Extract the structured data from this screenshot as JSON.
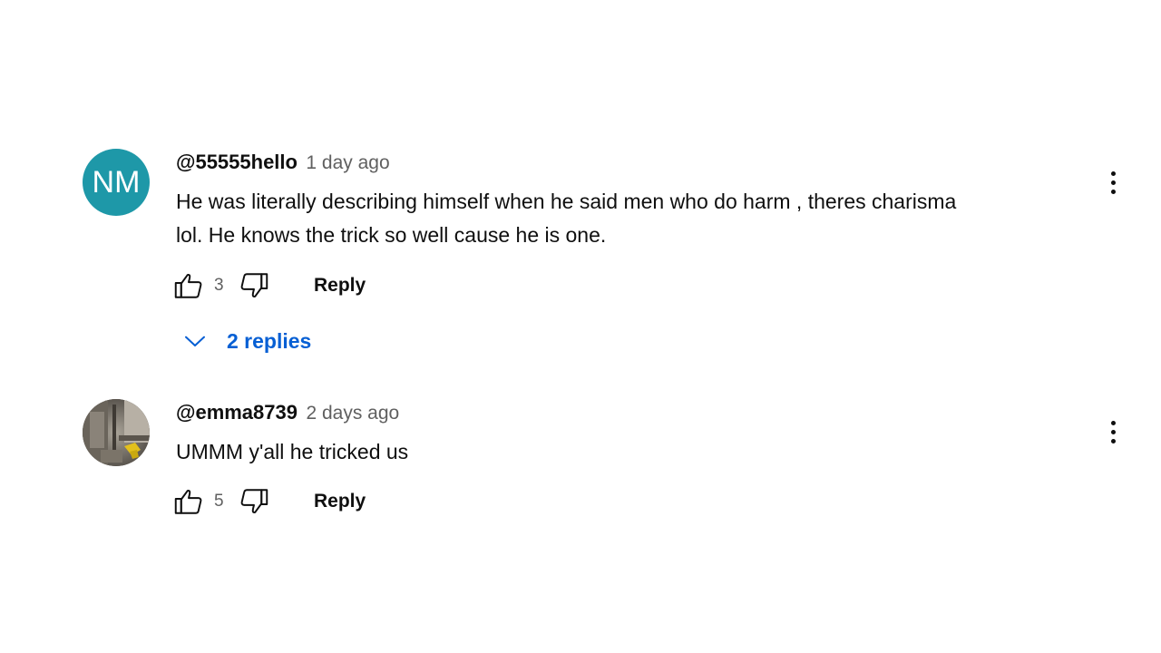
{
  "comments": [
    {
      "avatar_initials": "NM",
      "avatar_color": "#1e98a8",
      "author": "@55555hello",
      "timestamp": "1 day ago",
      "text_lines": [
        "He was literally describing himself when he said men who do harm , theres charisma",
        "lol. He knows the trick so well cause he is one."
      ],
      "like_count": "3",
      "reply_label": "Reply",
      "replies_label": "2 replies"
    },
    {
      "author": "@emma8739",
      "timestamp": "2 days ago",
      "text": "UMMM y'all he tricked us",
      "like_count": "5",
      "reply_label": "Reply"
    }
  ],
  "icons": {
    "like": "thumbs-up-icon",
    "dislike": "thumbs-down-icon",
    "menu": "more-vert-icon",
    "expand": "chevron-down-icon"
  },
  "colors": {
    "link_blue": "#065fd4",
    "secondary_text": "#606060"
  }
}
